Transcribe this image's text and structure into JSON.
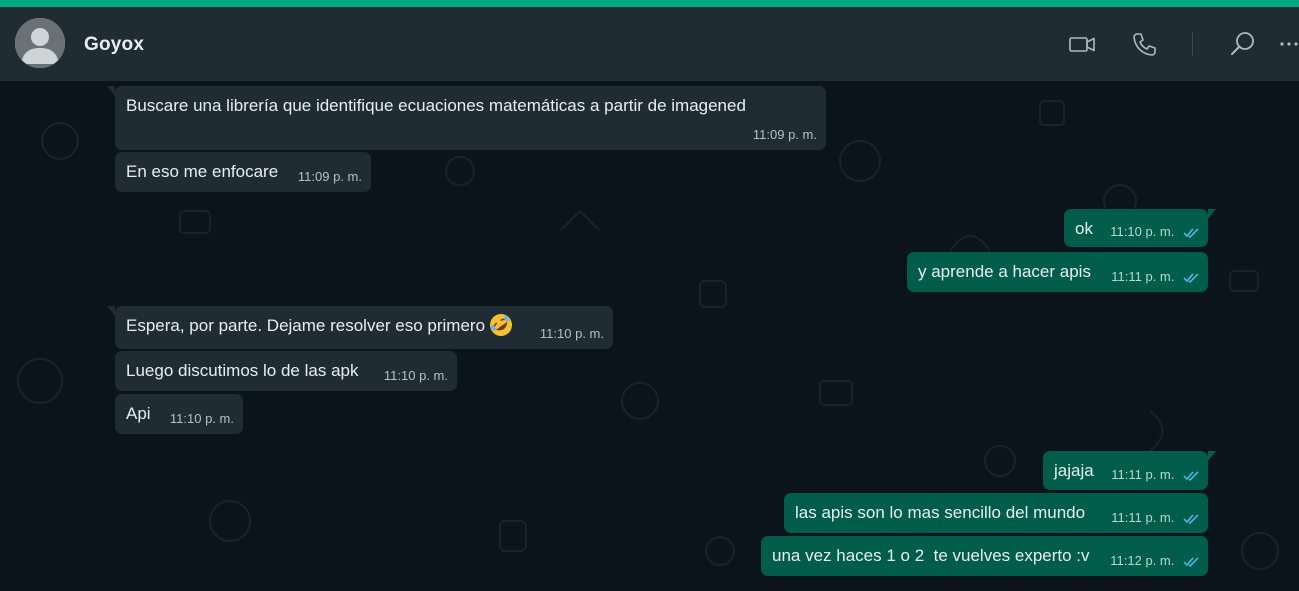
{
  "colors": {
    "accent": "#00a884",
    "header_bg": "#202c33",
    "chat_bg": "#0b141a",
    "incoming_bubble": "#202c33",
    "outgoing_bubble": "#005c4b",
    "read_ticks": "#53bdeb"
  },
  "header": {
    "contact_name": "Goyox",
    "icons": [
      "avatar-icon",
      "video-call-icon",
      "voice-call-icon",
      "search-icon",
      "menu-icon"
    ]
  },
  "messages": [
    {
      "direction": "incoming",
      "text": "Buscare una librería que identifique ecuaciones matemáticas a partir de imagened",
      "time": "11:09 p. m.",
      "tail": true
    },
    {
      "direction": "incoming",
      "text": "En eso me enfocare",
      "time": "11:09 p. m.",
      "tail": false
    },
    {
      "direction": "outgoing",
      "text": "ok",
      "time": "11:10 p. m.",
      "status": "read",
      "tail": true
    },
    {
      "direction": "outgoing",
      "text": "y aprende a hacer apis",
      "time": "11:11 p. m.",
      "status": "read",
      "tail": false
    },
    {
      "direction": "incoming",
      "text": "Espera, por parte. Dejame resolver eso primero",
      "emoji": "rolling-on-floor-laughing-emoji",
      "time": "11:10 p. m.",
      "tail": true
    },
    {
      "direction": "incoming",
      "text": "Luego discutimos lo de las apk",
      "time": "11:10 p. m.",
      "tail": false
    },
    {
      "direction": "incoming",
      "text": "Api",
      "time": "11:10 p. m.",
      "tail": false
    },
    {
      "direction": "outgoing",
      "text": "jajaja",
      "time": "11:11 p. m.",
      "status": "read",
      "tail": true
    },
    {
      "direction": "outgoing",
      "text": "las apis son lo mas sencillo del mundo",
      "time": "11:11 p. m.",
      "status": "read",
      "tail": false
    },
    {
      "direction": "outgoing",
      "text": "una vez haces 1 o 2  te vuelves experto :v",
      "time": "11:12 p. m.",
      "status": "read",
      "tail": false
    }
  ]
}
